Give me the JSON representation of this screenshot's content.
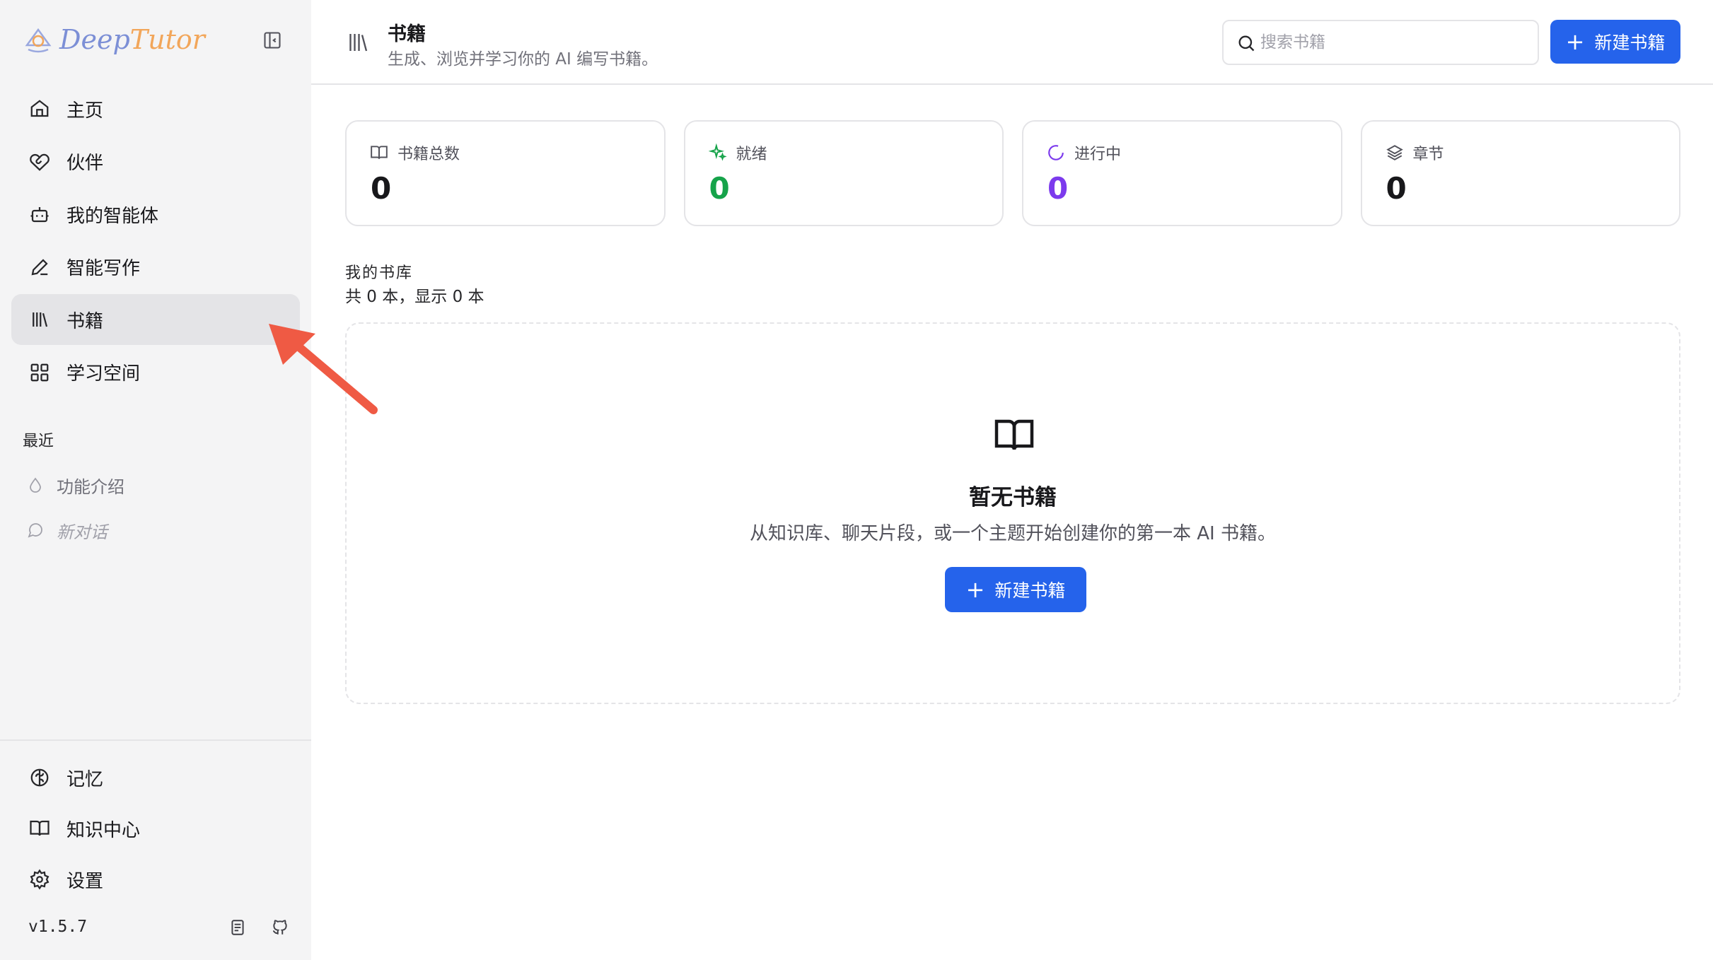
{
  "brand": {
    "name_part1": "Deep",
    "name_part2": "Tutor"
  },
  "sidebar": {
    "nav_items": [
      {
        "label": "主页",
        "icon": "home-icon"
      },
      {
        "label": "伙伴",
        "icon": "heart-handshake-icon"
      },
      {
        "label": "我的智能体",
        "icon": "bot-icon"
      },
      {
        "label": "智能写作",
        "icon": "pen-icon"
      },
      {
        "label": "书籍",
        "icon": "library-icon",
        "active": true
      },
      {
        "label": "学习空间",
        "icon": "grid-icon"
      }
    ],
    "recent_title": "最近",
    "recent_items": [
      {
        "label": "功能介绍",
        "icon": "droplet-icon"
      },
      {
        "label": "新对话",
        "icon": "message-icon"
      }
    ],
    "bottom_items": [
      {
        "label": "记忆",
        "icon": "brain-icon"
      },
      {
        "label": "知识中心",
        "icon": "book-open-icon"
      },
      {
        "label": "设置",
        "icon": "gear-icon"
      }
    ],
    "version": "v1.5.7"
  },
  "header": {
    "title": "书籍",
    "subtitle": "生成、浏览并学习你的 AI 编写书籍。",
    "search_placeholder": "搜索书籍",
    "new_button": "新建书籍"
  },
  "stats": [
    {
      "label": "书籍总数",
      "value": "0",
      "icon": "book-open-icon",
      "color": "#18181b"
    },
    {
      "label": "就绪",
      "value": "0",
      "icon": "sparkles-icon",
      "color": "#16a34a"
    },
    {
      "label": "进行中",
      "value": "0",
      "icon": "loader-icon",
      "color": "#7c3aed"
    },
    {
      "label": "章节",
      "value": "0",
      "icon": "layers-icon",
      "color": "#18181b"
    }
  ],
  "library": {
    "title": "我的书库",
    "count_text": "共 0 本，显示 0 本"
  },
  "empty_state": {
    "title": "暂无书籍",
    "description": "从知识库、聊天片段，或一个主题开始创建你的第一本 AI 书籍。",
    "button": "新建书籍"
  },
  "colors": {
    "accent": "#2563eb",
    "ready": "#16a34a",
    "in_progress": "#7c3aed",
    "annotation": "#ef5a44"
  }
}
